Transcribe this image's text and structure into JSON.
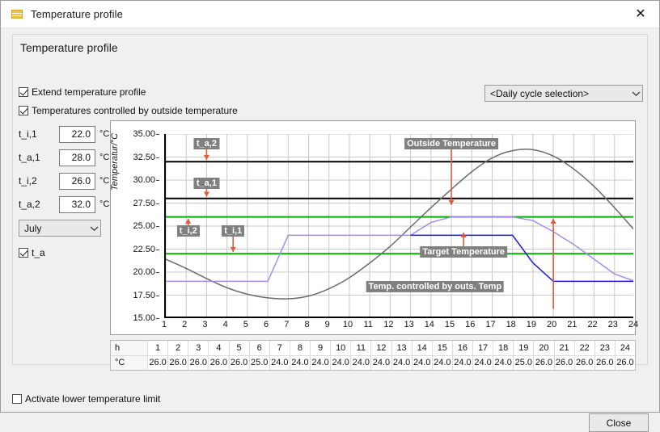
{
  "window": {
    "title": "Temperature profile",
    "icon": "calendar-grid-icon",
    "close_icon": "close-icon"
  },
  "group": {
    "title": "Temperature profile"
  },
  "checkboxes": {
    "extend": {
      "label": "Extend temperature profile",
      "checked": true
    },
    "controlled": {
      "label": "Temperatures controlled by outside temperature",
      "checked": true
    },
    "ta": {
      "label": "t_a",
      "checked": true
    },
    "lower_limit": {
      "label": "Activate lower temperature limit",
      "checked": false
    }
  },
  "fields": [
    {
      "label": "t_i,1",
      "value": "22.0",
      "unit": "°C"
    },
    {
      "label": "t_a,1",
      "value": "28.0",
      "unit": "°C"
    },
    {
      "label": "t_i,2",
      "value": "26.0",
      "unit": "°C"
    },
    {
      "label": "t_a,2",
      "value": "32.0",
      "unit": "°C"
    }
  ],
  "month_select": {
    "value": "July",
    "icon": "chevron-down-icon"
  },
  "cycle_select": {
    "value": "<Daily cycle selection>",
    "icon": "chevron-down-icon"
  },
  "footer": {
    "close_label": "Close"
  },
  "table": {
    "row_headers": [
      "h",
      "°C"
    ],
    "hours": [
      "1",
      "2",
      "3",
      "4",
      "5",
      "6",
      "7",
      "8",
      "9",
      "10",
      "11",
      "12",
      "13",
      "14",
      "15",
      "16",
      "17",
      "18",
      "19",
      "20",
      "21",
      "22",
      "23",
      "24"
    ],
    "values": [
      "26.0",
      "26.0",
      "26.0",
      "26.0",
      "26.0",
      "25.0",
      "24.0",
      "24.0",
      "24.0",
      "24.0",
      "24.0",
      "24.0",
      "24.0",
      "24.0",
      "24.0",
      "24.0",
      "24.0",
      "24.0",
      "25.0",
      "26.0",
      "26.0",
      "26.0",
      "26.0",
      "26.0"
    ]
  },
  "chart_data": {
    "type": "line",
    "title": "",
    "xlabel": "",
    "ylabel": "Temperatur/°C",
    "ylim": [
      15.0,
      35.0
    ],
    "xlim": [
      1,
      24
    ],
    "yticks": [
      "35.00",
      "32.50",
      "30.00",
      "27.50",
      "25.00",
      "22.50",
      "20.00",
      "17.50",
      "15.00"
    ],
    "ytick_values": [
      35.0,
      32.5,
      30.0,
      27.5,
      25.0,
      22.5,
      20.0,
      17.5,
      15.0
    ],
    "xticks": [
      "1",
      "2",
      "3",
      "4",
      "5",
      "6",
      "7",
      "8",
      "9",
      "10",
      "11",
      "12",
      "13",
      "14",
      "15",
      "16",
      "17",
      "18",
      "19",
      "20",
      "21",
      "22",
      "23",
      "24"
    ],
    "grid": true,
    "legend_position": "none",
    "hlines": [
      {
        "name": "t_a,2",
        "value": 32.0,
        "color": "#000000",
        "width": 2
      },
      {
        "name": "t_a,1",
        "value": 28.0,
        "color": "#000000",
        "width": 2
      },
      {
        "name": "t_i,2",
        "value": 26.0,
        "color": "#00b000",
        "width": 2
      },
      {
        "name": "t_i,1",
        "value": 22.0,
        "color": "#00b000",
        "width": 2
      }
    ],
    "series": [
      {
        "name": "Outside Temperature",
        "color": "#6b6b6b",
        "width": 1.5,
        "x": [
          1,
          2,
          3,
          4,
          5,
          6,
          7,
          8,
          9,
          10,
          11,
          12,
          13,
          14,
          15,
          16,
          17,
          18,
          19,
          20,
          21,
          22,
          23,
          24
        ],
        "values": [
          21.4,
          20.4,
          19.3,
          18.3,
          17.6,
          17.2,
          17.1,
          17.4,
          18.2,
          19.4,
          21.0,
          22.8,
          24.9,
          27.0,
          29.0,
          30.9,
          32.4,
          33.2,
          33.3,
          32.6,
          31.2,
          29.3,
          27.0,
          24.5
        ]
      },
      {
        "name": "Target Temperature",
        "color": "#a38ee8",
        "width": 1.5,
        "x": [
          1,
          2,
          3,
          4,
          5,
          6,
          7,
          8,
          9,
          10,
          11,
          12,
          13,
          14,
          15,
          16,
          17,
          18,
          19,
          20,
          21,
          22,
          23,
          24
        ],
        "values": [
          19.0,
          19.0,
          19.0,
          19.0,
          19.0,
          19.0,
          24.0,
          24.0,
          24.0,
          24.0,
          24.0,
          24.0,
          24.0,
          25.4,
          26.0,
          26.0,
          26.0,
          26.0,
          25.6,
          24.4,
          23.0,
          21.4,
          19.8,
          19.0
        ]
      },
      {
        "name": "Temp. controlled by outs. Temp",
        "color": "#1a1ad0",
        "width": 1.5,
        "x": [
          13,
          14,
          15,
          16,
          17,
          18,
          19,
          20,
          21,
          22,
          23,
          24
        ],
        "values": [
          24.0,
          24.0,
          24.0,
          24.0,
          24.0,
          24.0,
          21.0,
          19.0,
          19.0,
          19.0,
          19.0,
          19.0
        ]
      }
    ],
    "annotations": [
      {
        "label": "t_a,2",
        "x": 3.0,
        "y": 33.9,
        "arrow": "down",
        "arrow_from": 34.0,
        "arrow_to": 32.2
      },
      {
        "label": "t_a,1",
        "x": 3.0,
        "y": 29.6,
        "arrow": "down",
        "arrow_from": 29.8,
        "arrow_to": 28.2
      },
      {
        "label": "t_i,2",
        "x": 2.1,
        "y": 24.4,
        "arrow": "up",
        "arrow_from": 24.4,
        "arrow_to": 25.8
      },
      {
        "label": "t_i,1",
        "x": 4.3,
        "y": 24.4,
        "arrow": "down",
        "arrow_from": 24.4,
        "arrow_to": 22.2
      },
      {
        "label": "Outside Temperature",
        "x": 15.0,
        "y": 33.9,
        "arrow": "down",
        "arrow_from": 33.5,
        "arrow_to": 27.3
      },
      {
        "label": "Target Temperature",
        "x": 15.6,
        "y": 22.1,
        "arrow": "up",
        "arrow_from": 21.9,
        "arrow_to": 24.3
      },
      {
        "label": "Temp. controlled by outs. Temp",
        "x": 14.2,
        "y": 18.3,
        "arrow": "up",
        "arrow_from": 16.0,
        "arrow_to": 25.8,
        "arrow_x": 20.0
      }
    ],
    "annotation_bg": "#808080",
    "arrow_color": "#e05a3c"
  }
}
